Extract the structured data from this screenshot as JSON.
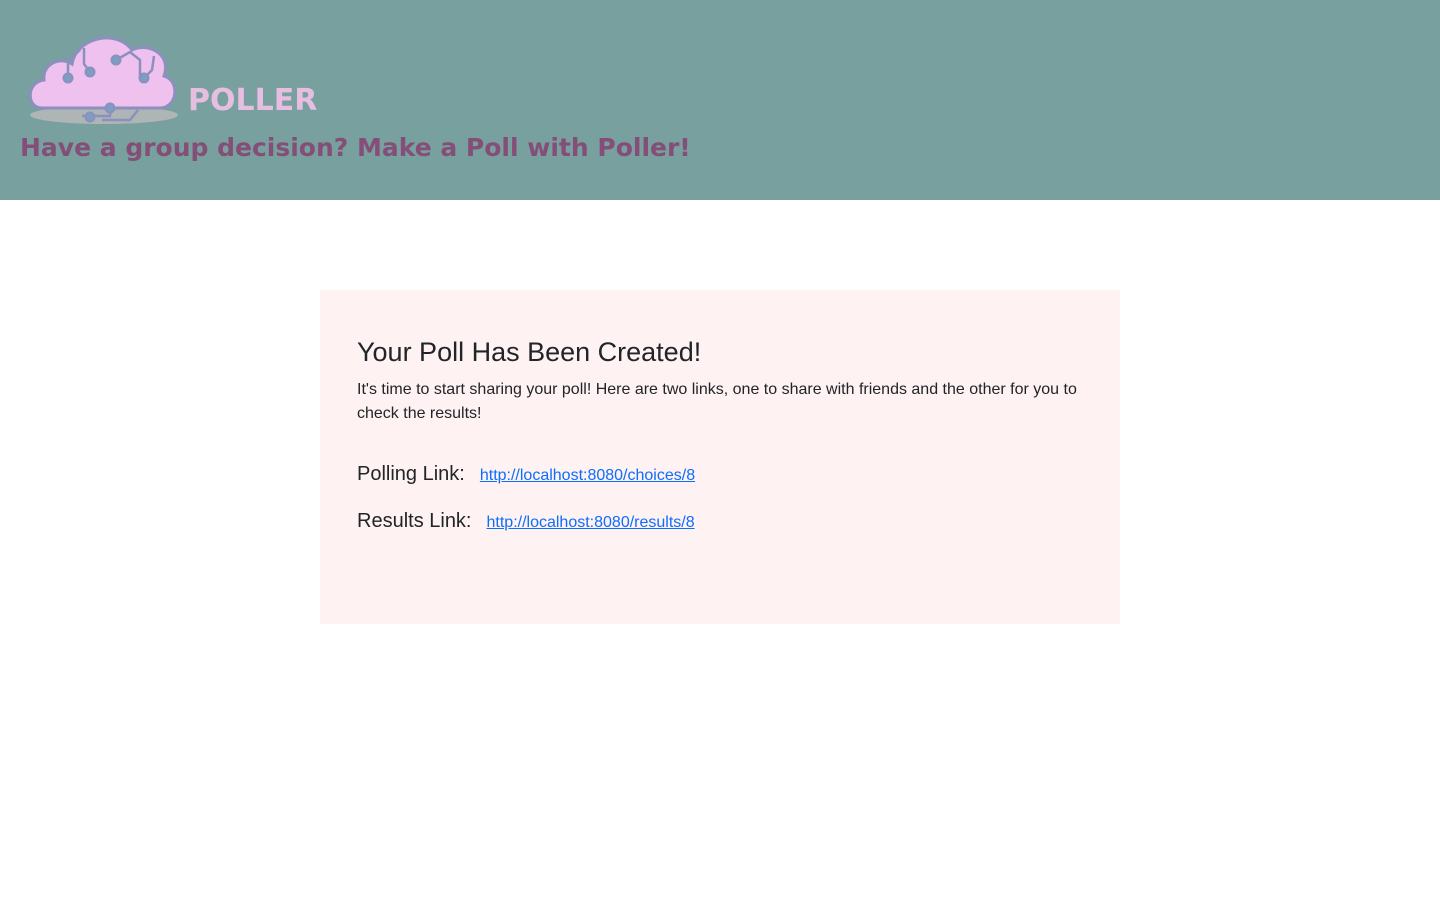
{
  "header": {
    "brand_name": "POLLER",
    "tagline": "Have a group decision? Make a Poll with Poller!",
    "logo_icon": "cloud-circuit-icon",
    "background_color": "#77a09e",
    "brand_color": "#e8bde2",
    "tagline_color": "#854e78"
  },
  "card": {
    "title": "Your Poll Has Been Created!",
    "description": "It's time to start sharing your poll! Here are two links, one to share with friends and the other for you to check the results!",
    "background_color": "#fff2f2",
    "polling": {
      "label": "Polling Link:",
      "url": "http://localhost:8080/choices/8"
    },
    "results": {
      "label": "Results Link:",
      "url": "http://localhost:8080/results/8"
    },
    "link_color": "#0d6efd"
  }
}
